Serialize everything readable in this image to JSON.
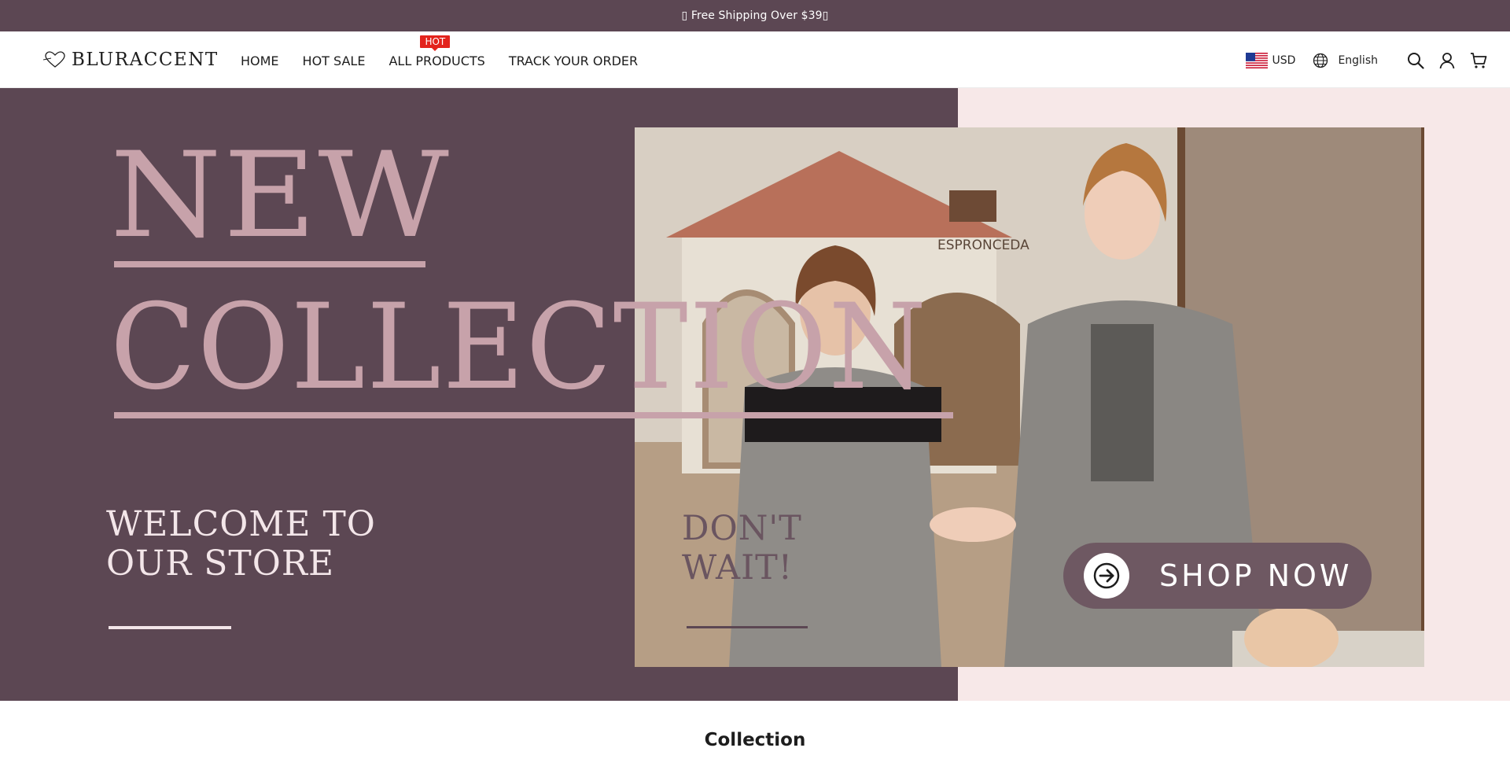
{
  "announcement": {
    "text": "▯ Free Shipping Over $39▯"
  },
  "header": {
    "logo_text": "BLURACCENT",
    "nav": [
      {
        "label": "HOME"
      },
      {
        "label": "HOT SALE"
      },
      {
        "label": "ALL PRODUCTS",
        "badge": "HOT"
      },
      {
        "label": "TRACK YOUR ORDER"
      }
    ],
    "currency": "USD",
    "language": "English",
    "icons": [
      "globe-icon",
      "search-icon",
      "account-icon",
      "cart-icon"
    ]
  },
  "hero": {
    "headline_1": "NEW",
    "headline_2": "COLLECTION",
    "welcome_1": "WELCOME TO",
    "welcome_2": "OUR STORE",
    "dontwait_1": "DON'T",
    "dontwait_2": "WAIT!",
    "photo_sign": "ESPRONCEDA",
    "cta": "SHOP NOW",
    "colors": {
      "plum": "#5c4753",
      "pink": "#c7a2aa",
      "blush": "#f7e8e8"
    }
  },
  "section": {
    "title": "Collection"
  }
}
